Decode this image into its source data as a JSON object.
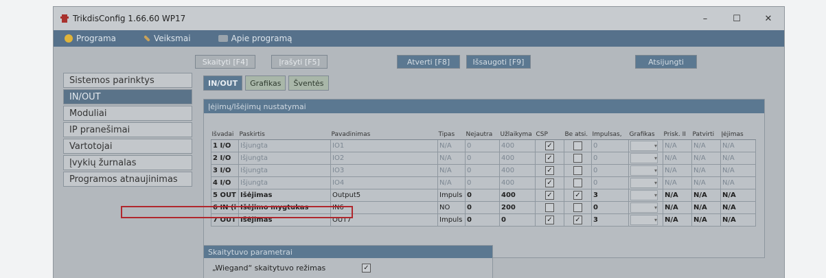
{
  "window": {
    "title": "TrikdisConfig 1.66.60   WP17",
    "controls": {
      "minimize": "–",
      "maximize": "☐",
      "close": "✕"
    }
  },
  "menu": [
    {
      "label": "Programa",
      "icon": "gear-icon"
    },
    {
      "label": "Veiksmai",
      "icon": "wrench-icon"
    },
    {
      "label": "Apie programą",
      "icon": "info-card-icon"
    }
  ],
  "toolbar": {
    "read": "Skaityti [F4]",
    "write": "Įrašyti [F5]",
    "open": "Atverti [F8]",
    "save": "Išsaugoti [F9]",
    "disconnect": "Atsijungti"
  },
  "sidebar": [
    {
      "label": "Sistemos parinktys",
      "active": false
    },
    {
      "label": "IN/OUT",
      "active": true
    },
    {
      "label": "Moduliai",
      "active": false
    },
    {
      "label": "IP pranešimai",
      "active": false
    },
    {
      "label": "Vartotojai",
      "active": false
    },
    {
      "label": "Įvykių žurnalas",
      "active": false
    },
    {
      "label": "Programos atnaujinimas",
      "active": false
    }
  ],
  "tabs": [
    {
      "label": "IN/OUT",
      "active": true
    },
    {
      "label": "Grafikas",
      "active": false
    },
    {
      "label": "Šventės",
      "active": false
    }
  ],
  "io_panel": {
    "title": "Įėjimų/Išėjimų nustatymai",
    "columns": [
      "Išvadai",
      "Paskirtis",
      "Pavadinimas",
      "Tipas",
      "Nejautra",
      "Užlaikyma",
      "CSP",
      "Be atsi.",
      "Impulsas,",
      "Grafikas",
      "Prisk. II",
      "Patvirti",
      "Įėjimas"
    ],
    "rows": [
      {
        "pin": "1 I/O",
        "purpose": "Išjungta",
        "name": "IO1",
        "type": "N/A",
        "insens": "0",
        "delay": "400",
        "csp": true,
        "norestore": false,
        "pulse": "0",
        "schedule": "",
        "assign": "N/A",
        "confirm": "N/A",
        "input": "N/A",
        "strong": false
      },
      {
        "pin": "2 I/O",
        "purpose": "Išjungta",
        "name": "IO2",
        "type": "N/A",
        "insens": "0",
        "delay": "400",
        "csp": true,
        "norestore": false,
        "pulse": "0",
        "schedule": "",
        "assign": "N/A",
        "confirm": "N/A",
        "input": "N/A",
        "strong": false
      },
      {
        "pin": "3 I/O",
        "purpose": "Išjungta",
        "name": "IO3",
        "type": "N/A",
        "insens": "0",
        "delay": "400",
        "csp": true,
        "norestore": false,
        "pulse": "0",
        "schedule": "",
        "assign": "N/A",
        "confirm": "N/A",
        "input": "N/A",
        "strong": false
      },
      {
        "pin": "4 I/O",
        "purpose": "Išjungta",
        "name": "IO4",
        "type": "N/A",
        "insens": "0",
        "delay": "400",
        "csp": true,
        "norestore": false,
        "pulse": "0",
        "schedule": "",
        "assign": "N/A",
        "confirm": "N/A",
        "input": "N/A",
        "strong": false
      },
      {
        "pin": "5 OUT",
        "purpose": "Išėjimas",
        "name": "Output5",
        "type": "Impuls",
        "insens": "0",
        "delay": "400",
        "csp": true,
        "norestore": true,
        "pulse": "3",
        "schedule": "",
        "assign": "N/A",
        "confirm": "N/A",
        "input": "N/A",
        "strong": true
      },
      {
        "pin": "6 IN (i",
        "purpose": "Išėjimo mygtukas",
        "name": "IN6",
        "type": "NO",
        "insens": "0",
        "delay": "200",
        "csp": false,
        "norestore": false,
        "pulse": "0",
        "schedule": "",
        "assign": "N/A",
        "confirm": "N/A",
        "input": "N/A",
        "strong": true
      },
      {
        "pin": "7 OUT",
        "purpose": "Išėjimas",
        "name": "OUT7",
        "type": "Impuls",
        "insens": "0",
        "delay": "0",
        "csp": true,
        "norestore": true,
        "pulse": "3",
        "schedule": "",
        "assign": "N/A",
        "confirm": "N/A",
        "input": "N/A",
        "strong": true
      }
    ]
  },
  "reader_panel": {
    "title": "Skaitytuvo parametrai",
    "wiegand_label": "„Wiegand“ skaitytuvo režimas",
    "wiegand_checked": true
  }
}
